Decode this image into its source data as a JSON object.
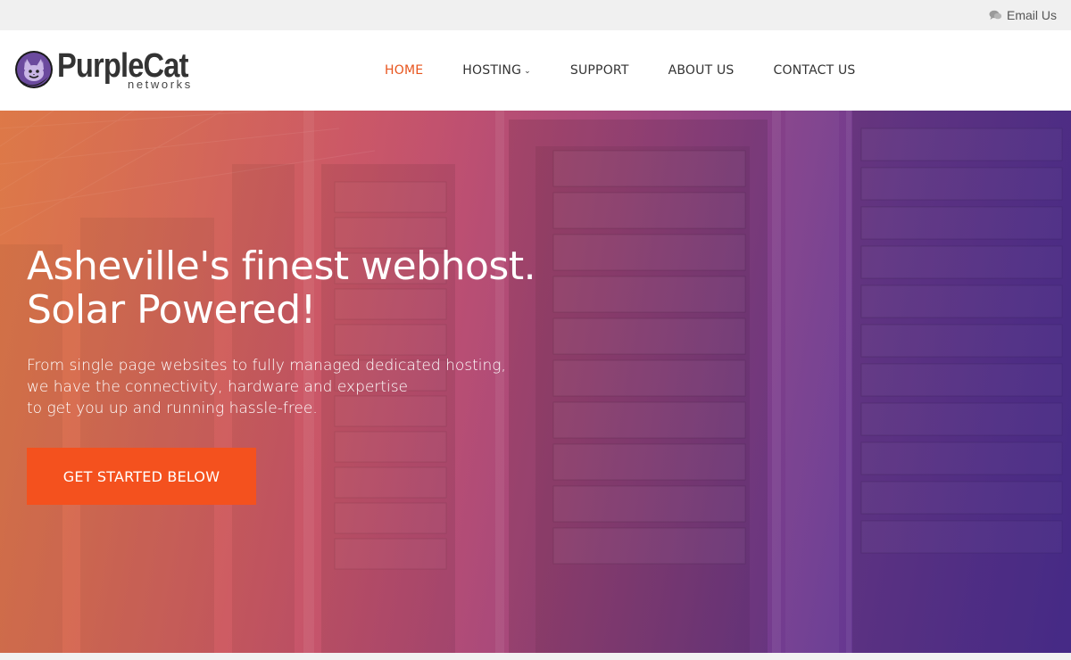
{
  "topbar": {
    "email_label": "Email Us",
    "email_icon": "chat-bubbles-icon"
  },
  "logo": {
    "brand": "PurpleCat",
    "tagline": "networks",
    "icon": "cat-face-icon"
  },
  "nav": {
    "items": [
      {
        "label": "HOME",
        "active": true
      },
      {
        "label": "HOSTING",
        "has_dropdown": true
      },
      {
        "label": "SUPPORT"
      },
      {
        "label": "ABOUT US"
      },
      {
        "label": "CONTACT US"
      }
    ]
  },
  "hero": {
    "headline_line1": "Asheville's finest webhost.",
    "headline_line2": "Solar Powered!",
    "lead_line1": "From single page websites to fully managed dedicated hosting,",
    "lead_line2": "we have the connectivity, hardware and expertise",
    "lead_line3": "to get you up and running hassle-free.",
    "cta_label": "GET STARTED BELOW",
    "background": "server-racks-image"
  },
  "colors": {
    "accent": "#f4511e",
    "nav_active": "#e8551e",
    "brand_purple": "#6b4a9e"
  }
}
